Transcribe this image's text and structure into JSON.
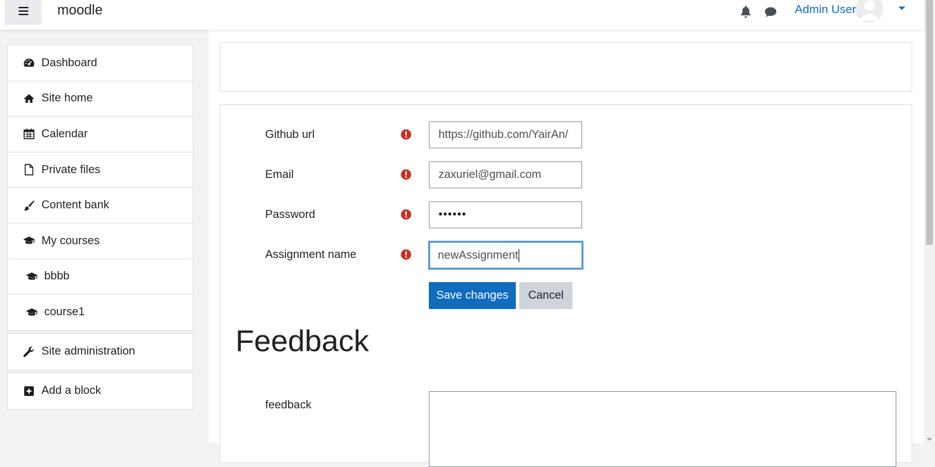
{
  "navbar": {
    "brand": "moodle",
    "user_name": "Admin User",
    "icons": {
      "menu": "hamburger-icon",
      "notifications": "bell-icon",
      "messages": "chat-icon",
      "user_menu": "caret-down-icon"
    }
  },
  "sidebar": {
    "items": [
      {
        "label": "Dashboard",
        "icon": "dashboard-icon"
      },
      {
        "label": "Site home",
        "icon": "home-icon"
      },
      {
        "label": "Calendar",
        "icon": "calendar-icon"
      },
      {
        "label": "Private files",
        "icon": "file-icon"
      },
      {
        "label": "Content bank",
        "icon": "paintbrush-icon"
      },
      {
        "label": "My courses",
        "icon": "graduation-cap-icon"
      },
      {
        "label": "bbbb",
        "icon": "graduation-cap-icon"
      },
      {
        "label": "course1",
        "icon": "graduation-cap-icon"
      }
    ],
    "site_admin": {
      "label": "Site administration",
      "icon": "wrench-icon"
    },
    "add_block": {
      "label": "Add a block",
      "icon": "plus-square-icon"
    }
  },
  "form": {
    "fields": [
      {
        "label": "Github url",
        "value": "https://github.com/YairAn/"
      },
      {
        "label": "Email",
        "value": "zaxuriel@gmail.com"
      },
      {
        "label": "Password",
        "value": "••••••"
      },
      {
        "label": "Assignment name",
        "value": "newAssignment"
      }
    ],
    "required_icon": "exclamation-circle-icon",
    "save_label": "Save changes",
    "cancel_label": "Cancel"
  },
  "feedback": {
    "heading": "Feedback",
    "field_label": "feedback"
  },
  "colors": {
    "primary": "#0f6cbf",
    "required": "#ca3120",
    "focus": "#5b9dd9"
  }
}
